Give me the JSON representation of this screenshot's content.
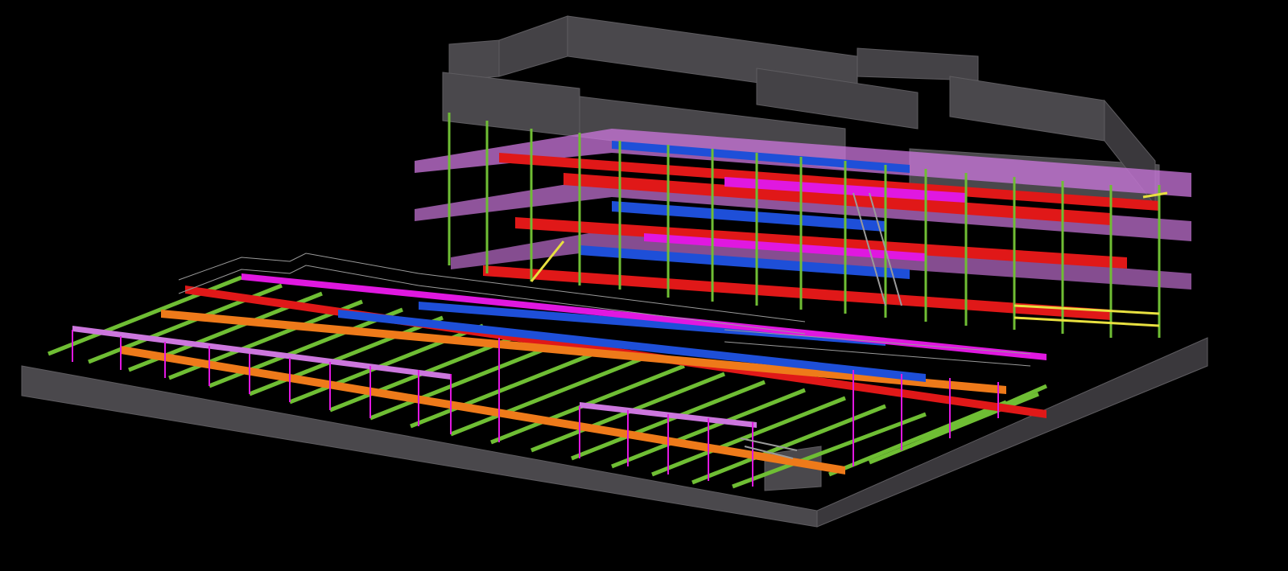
{
  "viewport": {
    "background": "#000000"
  },
  "model": {
    "style_colors": {
      "slab_edge": "#4a484c",
      "slab_edge_dark": "#3a383c",
      "steel_green": "#6fbe34",
      "steel_red": "#e01818",
      "steel_blue": "#1e4fd8",
      "steel_magenta": "#e018e0",
      "steel_orange": "#ee7a1a",
      "steel_yellow": "#e8e040",
      "deck_lilac": "#cc77dd",
      "rail_grey": "#9a9a9a"
    }
  }
}
